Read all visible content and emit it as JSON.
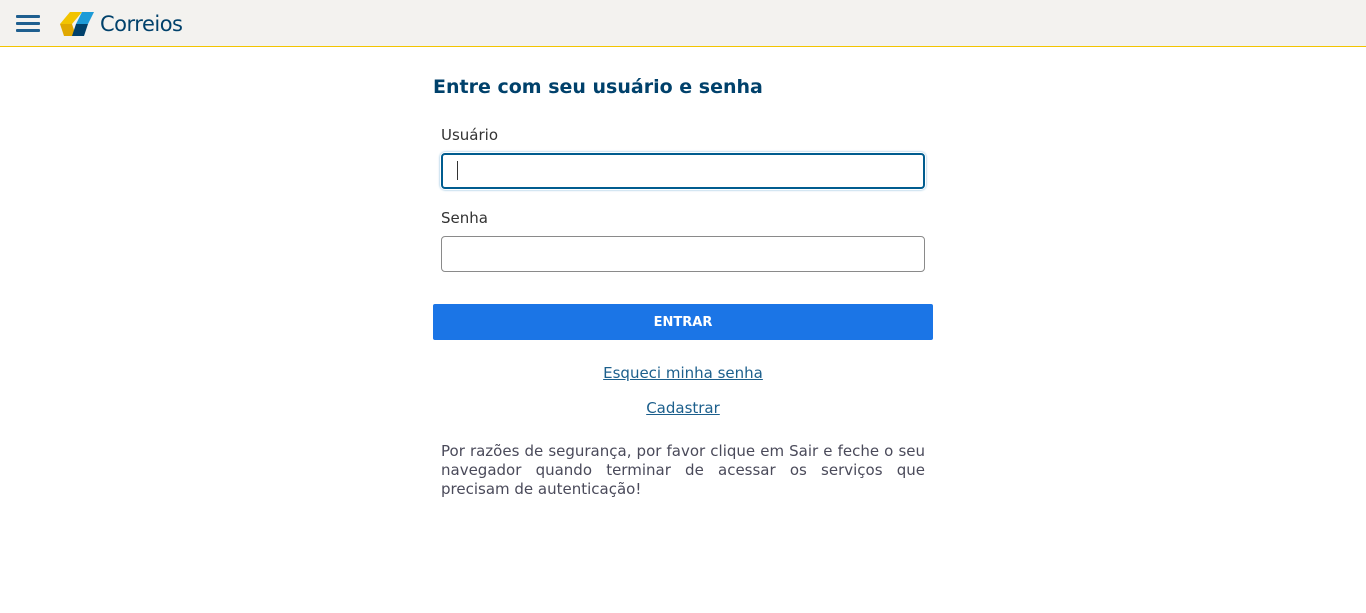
{
  "header": {
    "menu_icon": "hamburger-menu-icon",
    "logo_icon": "correios-logo-icon",
    "logo_text": "Correios",
    "colors": {
      "background": "#f3f2ef",
      "border": "#f2c400",
      "brand_blue": "#00416b",
      "logo_yellow": "#f2c400",
      "logo_blue": "#1d9bd7"
    }
  },
  "login": {
    "title": "Entre com seu usuário e senha",
    "username_label": "Usuário",
    "username_value": "",
    "password_label": "Senha",
    "password_value": "",
    "submit_label": "ENTRAR",
    "forgot_link": "Esqueci minha senha",
    "register_link": "Cadastrar",
    "notice": "Por razões de segurança, por favor clique em Sair e feche o seu navegador quando terminar de acessar os serviços que precisam de autenticação!",
    "colors": {
      "button": "#1b75e6",
      "title": "#00416b",
      "link": "#1c5f8c"
    }
  }
}
